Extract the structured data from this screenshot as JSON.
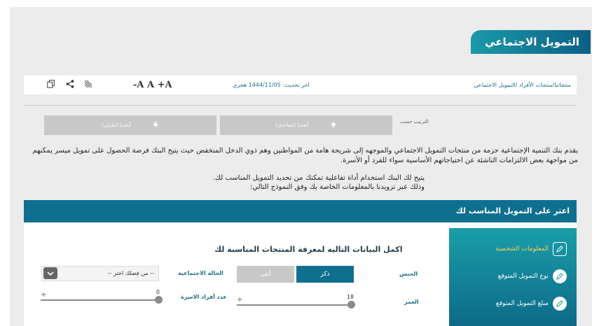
{
  "page": {
    "title": "التمويل الاجتماعي"
  },
  "breadcrumb": {
    "text": "منتجاتنا/منتجات الأفراد /التمويل الاجتماعي"
  },
  "toolbar": {
    "last_updated": "اخر تحديث: 1444/11/05 هجري",
    "font_size_controls": "-A A +A",
    "icons": [
      "print-icon",
      "share-icon",
      "rss-icon"
    ]
  },
  "sort": {
    "label": "الترتيب حسب",
    "buttons": [
      {
        "label": "أبجديا (تصاعدي)",
        "icon": "arrow-up-icon"
      },
      {
        "label": "أبجديا (تنازلي)",
        "icon": "arrow-down-icon"
      }
    ]
  },
  "description": {
    "paragraph1": "يقدم بنك التنمية الإجتماعية حزمة من منتجات التمويل الاجتماعي والموجهه إلى شريحة هامة من المواطنين وهم ذوي الدخل المنخفض حيث يتيح البنك فرصة الحصول على تمويل ميسر يمكنهم من مواجهة بعض الالتزامات الناشئة عن احتياجاتهم الأساسية سواء للفرد أو الأسرة.",
    "paragraph2_line1": "يتيح لك البنك استخدام أداة تفاعلية تمكنك من تحديد التمويل المناسب لك.",
    "paragraph2_line2": "وذلك عبر تزويدنا بالمعلومات الخاصة بك وفق النموذج التالي:"
  },
  "finder": {
    "header": "اعثر على التمويل المناسب لك",
    "steps": [
      {
        "label": "المعلومات الشخصية",
        "active": true
      },
      {
        "label": "نوع التمويل المتوقع",
        "active": false
      },
      {
        "label": "مبلغ التمويل المتوقع",
        "active": false
      }
    ],
    "form_title": "اكمل البيانات التالية لمعرفة المنتجات المناسبة لك",
    "gender_label": "الجنس",
    "gender_male": "ذكر",
    "gender_female": "أنثى",
    "marital_label": "الحالة الاجتماعية",
    "marital_value": "-- من فضلك اختر --",
    "age_label": "العمر",
    "age_value": "18",
    "family_label": "عدد أفراد الاسرة",
    "family_value": "0",
    "age_slider_fraction": 0,
    "family_slider_fraction": 0
  },
  "colors": {
    "accent": "#0f6f8f",
    "teal": "#1a9eaa",
    "highlight": "#ffd24d"
  }
}
